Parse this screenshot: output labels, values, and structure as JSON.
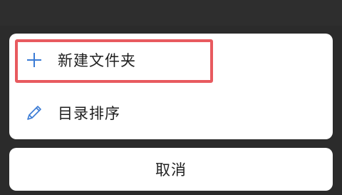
{
  "action_sheet": {
    "items": [
      {
        "label": "新建文件夹",
        "icon": "plus-icon"
      },
      {
        "label": "目录排序",
        "icon": "pencil-icon"
      }
    ]
  },
  "cancel": {
    "label": "取消"
  },
  "colors": {
    "backdrop": "#2b2b2b",
    "sheet_bg": "#ffffff",
    "icon_blue": "#3a7bd5",
    "highlight_red": "#e85a5f",
    "text": "#1f1f1f"
  }
}
